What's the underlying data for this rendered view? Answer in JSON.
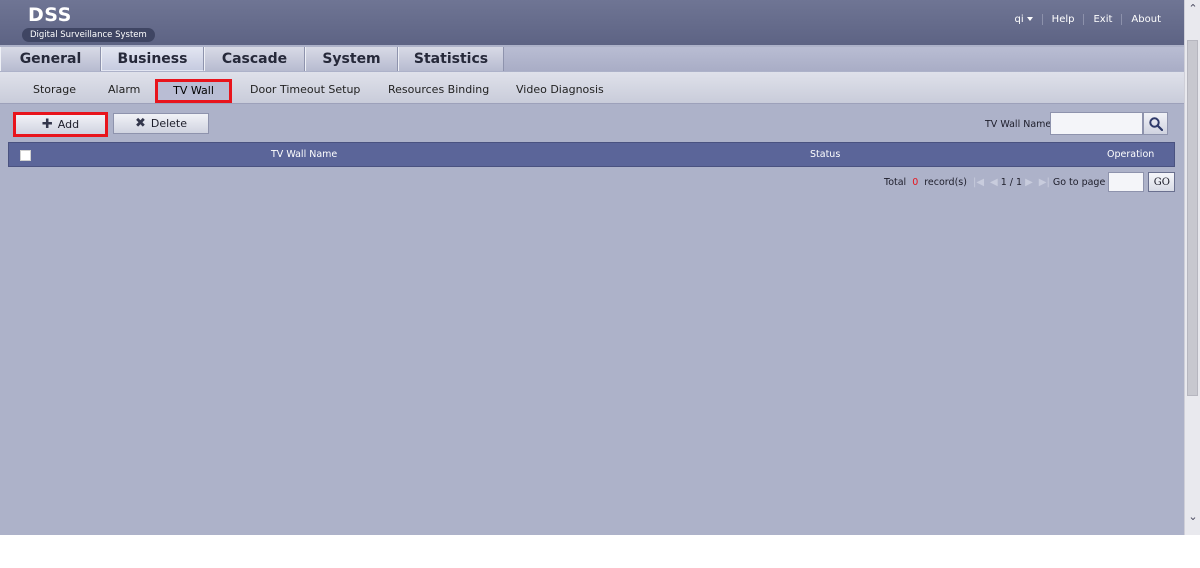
{
  "header": {
    "logo_title": "DSS",
    "logo_subtitle": "Digital Surveillance System",
    "user": "qi",
    "links": [
      "Help",
      "Exit",
      "About"
    ]
  },
  "main_tabs": [
    {
      "label": "General",
      "active": false
    },
    {
      "label": "Business",
      "active": true
    },
    {
      "label": "Cascade",
      "active": false
    },
    {
      "label": "System",
      "active": false
    },
    {
      "label": "Statistics",
      "active": false
    }
  ],
  "sub_tabs": {
    "storage": "Storage",
    "alarm": "Alarm",
    "tv_wall": "TV Wall",
    "door_timeout": "Door Timeout Setup",
    "resources_binding": "Resources Binding",
    "video_diagnosis": "Video Diagnosis",
    "active": "TV Wall"
  },
  "toolbar": {
    "add_label": "Add",
    "add_icon": "plus-icon",
    "delete_label": "Delete",
    "delete_icon": "x-icon"
  },
  "search": {
    "label": "TV Wall Name:",
    "value": "",
    "icon": "search-icon"
  },
  "table": {
    "columns": [
      "TV Wall Name",
      "Status",
      "Operation"
    ],
    "rows": []
  },
  "pager": {
    "total_label": "Total",
    "total_count": "0",
    "records_label": "record(s)",
    "page_display": "1 / 1",
    "goto_label": "Go to page",
    "go_button": "GO"
  },
  "colors": {
    "highlight": "#e8141c",
    "table_header": "#5b6599",
    "background": "#adb2c9"
  }
}
